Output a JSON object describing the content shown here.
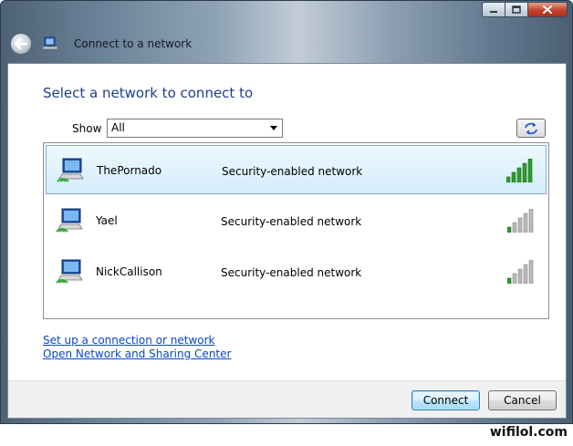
{
  "window": {
    "title": "Connect to a network",
    "caption_buttons": {
      "minimize": "minimize-icon",
      "maximize": "maximize-icon",
      "close": "close-icon"
    }
  },
  "main": {
    "heading": "Select a network to connect to",
    "show": {
      "label": "Show",
      "selected": "All"
    },
    "refresh_icon": "refresh-icon",
    "networks": [
      {
        "name": "ThePornado",
        "security": "Security-enabled network",
        "signal_bars": 5,
        "selected": true
      },
      {
        "name": "Yael",
        "security": "Security-enabled network",
        "signal_bars": 1,
        "selected": false
      },
      {
        "name": "NickCallison",
        "security": "Security-enabled network",
        "signal_bars": 1,
        "selected": false
      }
    ],
    "links": {
      "setup": "Set up a connection or network",
      "sharing_center": "Open Network and Sharing Center"
    }
  },
  "footer": {
    "connect_label": "Connect",
    "cancel_label": "Cancel"
  },
  "watermark": "wifilol.com",
  "colors": {
    "heading": "#1e3d8f",
    "link": "#0a46c8",
    "signal_on": "#2e9b2e",
    "signal_off": "#b8b8b8",
    "selection_border": "#84acdd"
  }
}
